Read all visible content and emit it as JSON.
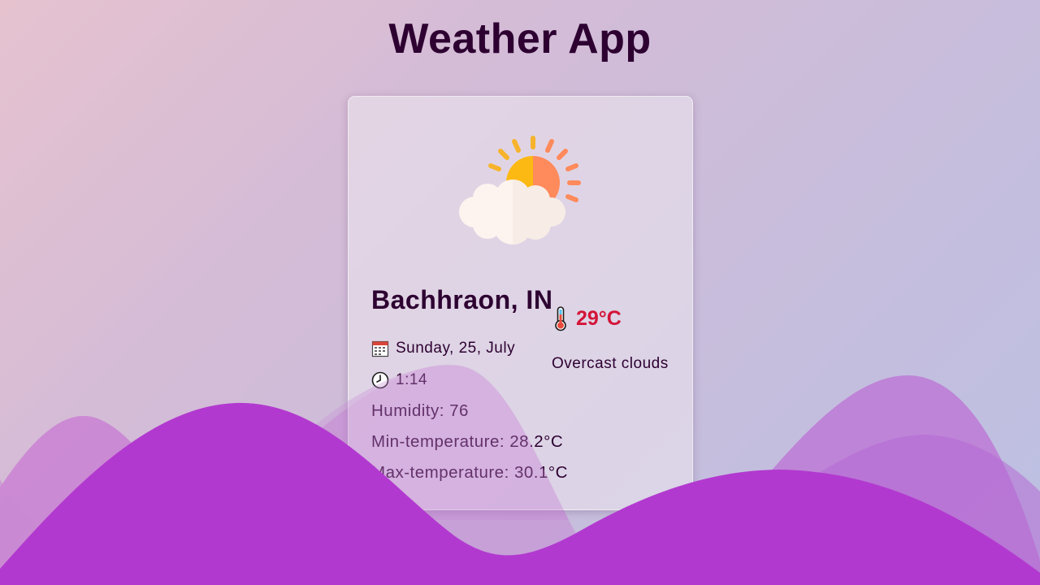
{
  "app": {
    "title": "Weather App"
  },
  "weather": {
    "city": "Bachhraon, IN",
    "temperature": "29°C",
    "description": "Overcast clouds",
    "date": "Sunday, 25, July",
    "time": "1:14",
    "humidity_label": "Humidity: 76",
    "min_temp_label": "Min-temperature: 28.2°C",
    "max_temp_label": "Max-temperature: 30.1°C",
    "icon": "sun-behind-cloud-icon"
  },
  "icons": {
    "thermometer": "thermometer-icon",
    "calendar": "calendar-icon",
    "clock": "clock-icon"
  },
  "colors": {
    "title_text": "#2d0031",
    "temperature": "#d31438",
    "wave_primary": "#b239cf",
    "card_background": "rgba(236,232,238,0.55)"
  }
}
